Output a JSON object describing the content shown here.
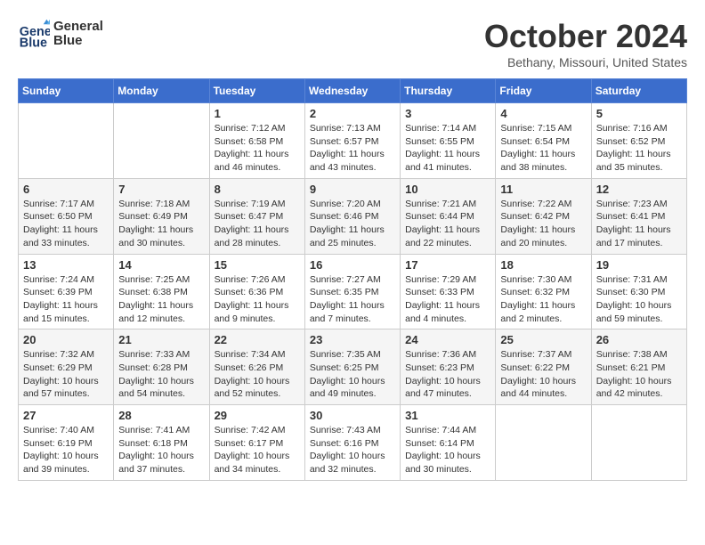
{
  "header": {
    "logo_line1": "General",
    "logo_line2": "Blue",
    "month": "October 2024",
    "location": "Bethany, Missouri, United States"
  },
  "weekdays": [
    "Sunday",
    "Monday",
    "Tuesday",
    "Wednesday",
    "Thursday",
    "Friday",
    "Saturday"
  ],
  "weeks": [
    [
      {
        "day": "",
        "info": ""
      },
      {
        "day": "",
        "info": ""
      },
      {
        "day": "1",
        "info": "Sunrise: 7:12 AM\nSunset: 6:58 PM\nDaylight: 11 hours and 46 minutes."
      },
      {
        "day": "2",
        "info": "Sunrise: 7:13 AM\nSunset: 6:57 PM\nDaylight: 11 hours and 43 minutes."
      },
      {
        "day": "3",
        "info": "Sunrise: 7:14 AM\nSunset: 6:55 PM\nDaylight: 11 hours and 41 minutes."
      },
      {
        "day": "4",
        "info": "Sunrise: 7:15 AM\nSunset: 6:54 PM\nDaylight: 11 hours and 38 minutes."
      },
      {
        "day": "5",
        "info": "Sunrise: 7:16 AM\nSunset: 6:52 PM\nDaylight: 11 hours and 35 minutes."
      }
    ],
    [
      {
        "day": "6",
        "info": "Sunrise: 7:17 AM\nSunset: 6:50 PM\nDaylight: 11 hours and 33 minutes."
      },
      {
        "day": "7",
        "info": "Sunrise: 7:18 AM\nSunset: 6:49 PM\nDaylight: 11 hours and 30 minutes."
      },
      {
        "day": "8",
        "info": "Sunrise: 7:19 AM\nSunset: 6:47 PM\nDaylight: 11 hours and 28 minutes."
      },
      {
        "day": "9",
        "info": "Sunrise: 7:20 AM\nSunset: 6:46 PM\nDaylight: 11 hours and 25 minutes."
      },
      {
        "day": "10",
        "info": "Sunrise: 7:21 AM\nSunset: 6:44 PM\nDaylight: 11 hours and 22 minutes."
      },
      {
        "day": "11",
        "info": "Sunrise: 7:22 AM\nSunset: 6:42 PM\nDaylight: 11 hours and 20 minutes."
      },
      {
        "day": "12",
        "info": "Sunrise: 7:23 AM\nSunset: 6:41 PM\nDaylight: 11 hours and 17 minutes."
      }
    ],
    [
      {
        "day": "13",
        "info": "Sunrise: 7:24 AM\nSunset: 6:39 PM\nDaylight: 11 hours and 15 minutes."
      },
      {
        "day": "14",
        "info": "Sunrise: 7:25 AM\nSunset: 6:38 PM\nDaylight: 11 hours and 12 minutes."
      },
      {
        "day": "15",
        "info": "Sunrise: 7:26 AM\nSunset: 6:36 PM\nDaylight: 11 hours and 9 minutes."
      },
      {
        "day": "16",
        "info": "Sunrise: 7:27 AM\nSunset: 6:35 PM\nDaylight: 11 hours and 7 minutes."
      },
      {
        "day": "17",
        "info": "Sunrise: 7:29 AM\nSunset: 6:33 PM\nDaylight: 11 hours and 4 minutes."
      },
      {
        "day": "18",
        "info": "Sunrise: 7:30 AM\nSunset: 6:32 PM\nDaylight: 11 hours and 2 minutes."
      },
      {
        "day": "19",
        "info": "Sunrise: 7:31 AM\nSunset: 6:30 PM\nDaylight: 10 hours and 59 minutes."
      }
    ],
    [
      {
        "day": "20",
        "info": "Sunrise: 7:32 AM\nSunset: 6:29 PM\nDaylight: 10 hours and 57 minutes."
      },
      {
        "day": "21",
        "info": "Sunrise: 7:33 AM\nSunset: 6:28 PM\nDaylight: 10 hours and 54 minutes."
      },
      {
        "day": "22",
        "info": "Sunrise: 7:34 AM\nSunset: 6:26 PM\nDaylight: 10 hours and 52 minutes."
      },
      {
        "day": "23",
        "info": "Sunrise: 7:35 AM\nSunset: 6:25 PM\nDaylight: 10 hours and 49 minutes."
      },
      {
        "day": "24",
        "info": "Sunrise: 7:36 AM\nSunset: 6:23 PM\nDaylight: 10 hours and 47 minutes."
      },
      {
        "day": "25",
        "info": "Sunrise: 7:37 AM\nSunset: 6:22 PM\nDaylight: 10 hours and 44 minutes."
      },
      {
        "day": "26",
        "info": "Sunrise: 7:38 AM\nSunset: 6:21 PM\nDaylight: 10 hours and 42 minutes."
      }
    ],
    [
      {
        "day": "27",
        "info": "Sunrise: 7:40 AM\nSunset: 6:19 PM\nDaylight: 10 hours and 39 minutes."
      },
      {
        "day": "28",
        "info": "Sunrise: 7:41 AM\nSunset: 6:18 PM\nDaylight: 10 hours and 37 minutes."
      },
      {
        "day": "29",
        "info": "Sunrise: 7:42 AM\nSunset: 6:17 PM\nDaylight: 10 hours and 34 minutes."
      },
      {
        "day": "30",
        "info": "Sunrise: 7:43 AM\nSunset: 6:16 PM\nDaylight: 10 hours and 32 minutes."
      },
      {
        "day": "31",
        "info": "Sunrise: 7:44 AM\nSunset: 6:14 PM\nDaylight: 10 hours and 30 minutes."
      },
      {
        "day": "",
        "info": ""
      },
      {
        "day": "",
        "info": ""
      }
    ]
  ]
}
